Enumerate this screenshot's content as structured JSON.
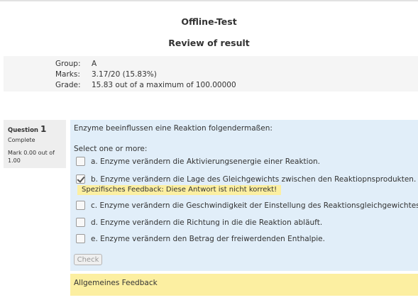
{
  "header": {
    "title": "Offline-Test",
    "subtitle": "Review of result"
  },
  "summary": {
    "rows": [
      {
        "label": "Group:",
        "value": "A"
      },
      {
        "label": "Marks:",
        "value": "3.17/20 (15.83%)"
      },
      {
        "label": "Grade:",
        "value": "15.83 out of a maximum of 100.00000"
      }
    ]
  },
  "question": {
    "label": "Question",
    "number": "1",
    "state": "Complete",
    "grade": "Mark 0.00 out of 1.00",
    "text": "Enzyme beeinflussen eine Reaktion folgendermaßen:",
    "prompt": "Select one or more:",
    "options": [
      {
        "label": "a. Enzyme verändern die Aktivierungsenergie einer Reaktion.",
        "checked": false
      },
      {
        "label": "b. Enzyme verändern die Lage des Gleichgewichts zwischen den Reaktiopnsprodukten.",
        "checked": true
      },
      {
        "label": "c. Enzyme verändern die Geschwindigkeit der Einstellung des Reaktionsgleichgewichtes.",
        "checked": false
      },
      {
        "label": "d. Enzyme verändern die Richtung in die die Reaktion abläuft.",
        "checked": false
      },
      {
        "label": "e. Enzyme verändern den Betrag der freiwerdenden Enthalpie.",
        "checked": false
      }
    ],
    "specific_feedback": "Spezifisches Feedback: Diese Antwort ist nicht korrekt!",
    "check_label": "Check",
    "general_feedback": "Allgemeines Feedback"
  },
  "colors": {
    "content_bg": "#e1eef9",
    "feedback_bg": "#fcefa1",
    "info_bg": "#eeeeee",
    "summary_bg": "#f5f5f5"
  }
}
